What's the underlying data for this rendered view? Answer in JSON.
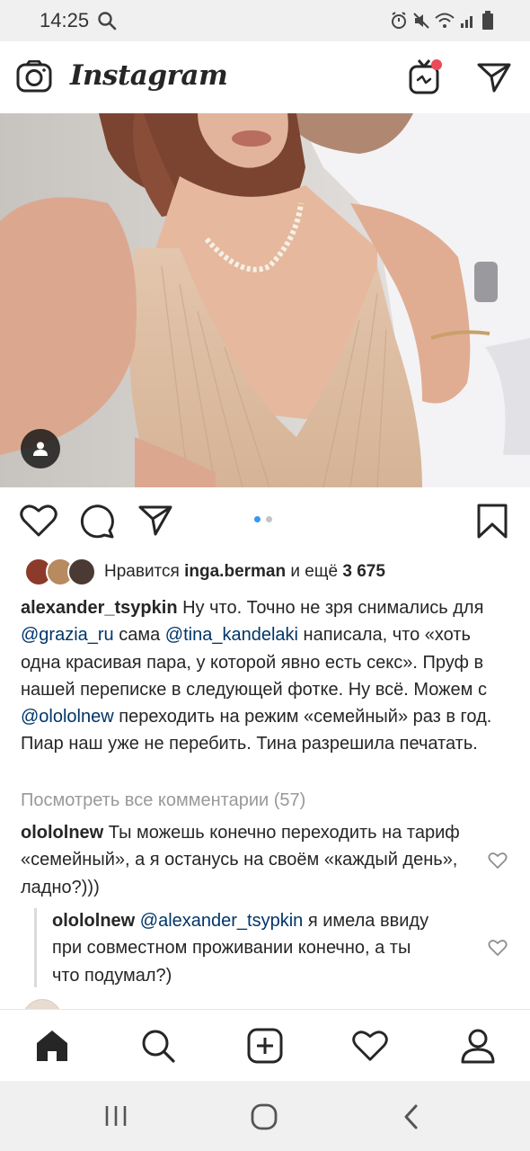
{
  "status_bar": {
    "time": "14:25",
    "battery": "7"
  },
  "header": {
    "app_title": "Instagram"
  },
  "likes": {
    "prefix": "Нравится",
    "user": "inga.berman",
    "middle": "и ещё",
    "count": "3 675"
  },
  "caption": {
    "author": "alexander_tsypkin",
    "part1": " Ну что. Точно не зря снимались для ",
    "mention1": "@grazia_ru",
    "part2": " сама ",
    "mention2": "@tina_kandelaki",
    "part3": " написала, что «хоть одна красивая пара, у которой явно есть секс». Пруф в нашей переписке в следующей фотке. Ну всё. Можем с ",
    "mention3": "@olololnew",
    "part4": " переходить на режим «семейный» раз в год. Пиар наш уже не перебить. Тина разрешила печатать."
  },
  "view_all_comments": "Посмотреть все комментарии (57)",
  "comments": [
    {
      "author": "olololnew",
      "text": " Ты можешь конечно переходить на тариф «семейный», а я останусь на своём «каждый день», ладно?)))"
    },
    {
      "author": "olololnew",
      "mention": "@alexander_tsypkin",
      "text": " я имела ввиду при совместном проживании конечно, а ты что подумал?)"
    }
  ],
  "carousel": {
    "count": 2,
    "active_index": 0
  },
  "colors": {
    "text": "#262626",
    "mention": "#003569",
    "muted": "#999999",
    "carousel_active": "#3897f0",
    "notification": "#ed4956"
  },
  "icons": {
    "camera": "camera-icon",
    "igtv": "igtv-icon",
    "direct": "paper-plane-icon",
    "like": "heart-icon",
    "comment": "speech-bubble-icon",
    "share": "paper-plane-icon",
    "save": "bookmark-icon",
    "home": "home-icon",
    "search": "search-icon",
    "add": "plus-square-icon",
    "activity": "heart-icon",
    "profile": "person-icon"
  }
}
